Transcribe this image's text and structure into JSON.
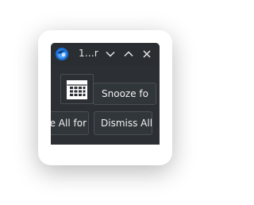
{
  "window": {
    "title": "1...r"
  },
  "titlebar": {
    "minimize_icon": "chevron-down-icon",
    "maximize_icon": "chevron-up-icon",
    "close_icon": "close-icon"
  },
  "reminder": {
    "icon": "calendar-icon",
    "snooze_label": "Snooze fo"
  },
  "footer": {
    "snooze_all_label": "Snooze All for",
    "dismiss_all_label": "Dismiss All"
  },
  "colors": {
    "window_bg": "#2c2f33",
    "titlebar_bg": "#2a2e32",
    "button_bg": "#31363b",
    "button_border": "#4b5056",
    "text": "#f0f0f0"
  }
}
